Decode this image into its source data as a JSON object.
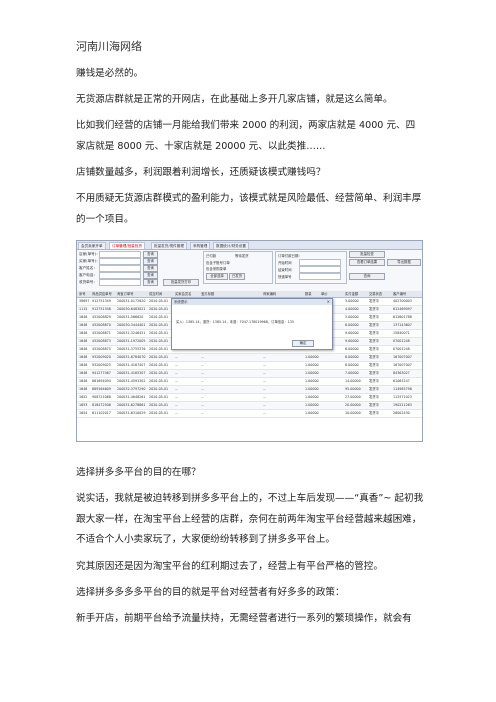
{
  "header": {
    "title": "河南川海网络"
  },
  "paragraphs_top": [
    "赚钱是必然的。",
    "无货源店群就是正常的开网店，在此基础上多开几家店铺，就是这么简单。",
    "比如我们经营的店铺一月能给我们带来 2000 的利润，两家店就是 4000 元、四家店就是 8000 元、十家店就是 20000 元、以此类推……",
    "店铺数量越多，利润跟着利润增长，还质疑该模式赚钱吗？",
    "不用质疑无货源店群模式的盈利能力，该模式就是风险最低、经营简单、利润丰厚的一个项目。"
  ],
  "paragraphs_bottom": [
    "选择拼多多平台的目的在哪？",
    "说实话，我就是被迫转移到拼多多平台上的，不过上车后发现——“真香”~ 起初我跟大家一样，在淘宝平台上经营的店群，奈何在前两年淘宝平台经营越来越困难，不适合个人小卖家玩了，大家便纷纷转移到了拼多多平台上。",
    "究其原因还是因为淘宝平台的红利期过去了，经营上有平台严格的管控。",
    "选择拼多多多多平台的目的就是平台对经营者有好多多的政策：",
    "新手开店，前期平台给予流量扶持，无需经营者进行一系列的繁琐操作，就会有"
  ],
  "screenshot": {
    "tabs": [
      "会员卖家开单",
      "订单管理/批量找货",
      "批量发货/揽件管理",
      "采购管理",
      "数据统计/财务设置"
    ],
    "form_labels": [
      "店家(单号)：",
      "买家(单号)：",
      "客户姓名：",
      "客户电话：",
      "收货单号："
    ],
    "search_label": "查询",
    "options": [
      "已付款",
      "等待发货",
      "包含子账号订单",
      "包含采购录单",
      "全部选择",
      "已发货"
    ],
    "right_labels": [
      "订单付款日期：",
      "开始时间",
      "结束时间",
      "快递单号"
    ],
    "buttons": [
      "批量检查",
      "查看订单结果",
      "导出数据",
      "查询",
      "批量发货打印"
    ],
    "grid_headers": [
      "序号",
      "商品供应单号",
      "淘宝订单号",
      "成交时间",
      "买家会员名",
      "宝贝标题",
      "商家编码",
      "数量",
      "单价",
      "实付金额",
      "交易状态",
      "客户编号"
    ],
    "grid_rows": [
      [
        "38697",
        "912751349",
        "200031-0172820",
        "2020-05-01",
        "…",
        "…",
        "…",
        "1.00000",
        "3.00000",
        "发货中",
        "402700003"
      ],
      [
        "1115",
        "912751348",
        "200030-6483021",
        "2020-05-01",
        "…",
        "…",
        "…",
        "1.00000",
        "4.00000",
        "发货中",
        "612469097"
      ],
      [
        "1648",
        "452008829",
        "200031-566820",
        "2020-05-01",
        "…",
        "…",
        "…",
        "1.00000",
        "5.00000",
        "发货中",
        "612601788"
      ],
      [
        "1648",
        "452008870",
        "200030-3444401",
        "2020-05-01",
        "…",
        "…",
        "…",
        "1.00000",
        "8.00000",
        "发货中",
        "137143607"
      ],
      [
        "1648",
        "452008871",
        "200031-3246451",
        "2020-05-01",
        "…",
        "…",
        "…",
        "1.00000",
        "9.00000",
        "发货中",
        "15840071"
      ],
      [
        "1648",
        "452008873",
        "200031-1972005",
        "2020-05-01",
        "…",
        "…",
        "…",
        "1.00000",
        "9.00000",
        "发货中",
        "07001248"
      ],
      [
        "1648",
        "452008875",
        "200031-3755376",
        "2020-05-01",
        "…",
        "…",
        "…",
        "1.00000",
        "6.00000",
        "发货中",
        "07001248"
      ],
      [
        "1648",
        "932009020",
        "200031-6784070",
        "2020-05-01",
        "…",
        "…",
        "…",
        "1.00000",
        "8.00000",
        "发货中",
        "167007007"
      ],
      [
        "1648",
        "932009025",
        "200031-4167407",
        "2020-05-01",
        "…",
        "…",
        "…",
        "1.00000",
        "8.00000",
        "发货中",
        "167007007"
      ],
      [
        "1648",
        "941277467",
        "200031-4165307",
        "2020-05-01",
        "…",
        "…",
        "…",
        "1.00000",
        "7.00000",
        "发货中",
        "84363027"
      ],
      [
        "1648",
        "861694094",
        "200031-4591302",
        "2020-05-01",
        "…",
        "…",
        "…",
        "1.00000",
        "14.00000",
        "发货中",
        "61063247"
      ],
      [
        "1648",
        "889164609",
        "200032-3797290",
        "2020-05-01",
        "…",
        "…",
        "…",
        "1.00000",
        "95.00000",
        "发货中",
        "114985798"
      ],
      [
        "1652",
        "908721068",
        "200031-4648261",
        "2020-05-01",
        "…",
        "…",
        "…",
        "1.00000",
        "27.00000",
        "发货中",
        "112571023"
      ],
      [
        "1653",
        "818472508",
        "200031-6278861",
        "2020-05-01",
        "…",
        "…",
        "…",
        "1.00000",
        "20.00000",
        "发货中",
        "190211263"
      ],
      [
        "1654",
        "611102017",
        "200031-6310029",
        "2020-05-01",
        "…",
        "…",
        "…",
        "1.00000",
        "10.00000",
        "发货中",
        "26002430"
      ]
    ],
    "dialog": {
      "title": "系统提示",
      "message": "买入：1385.14，退货：1385.14，未退：7047.178019968，订单信息：135",
      "ok": "确定"
    }
  }
}
